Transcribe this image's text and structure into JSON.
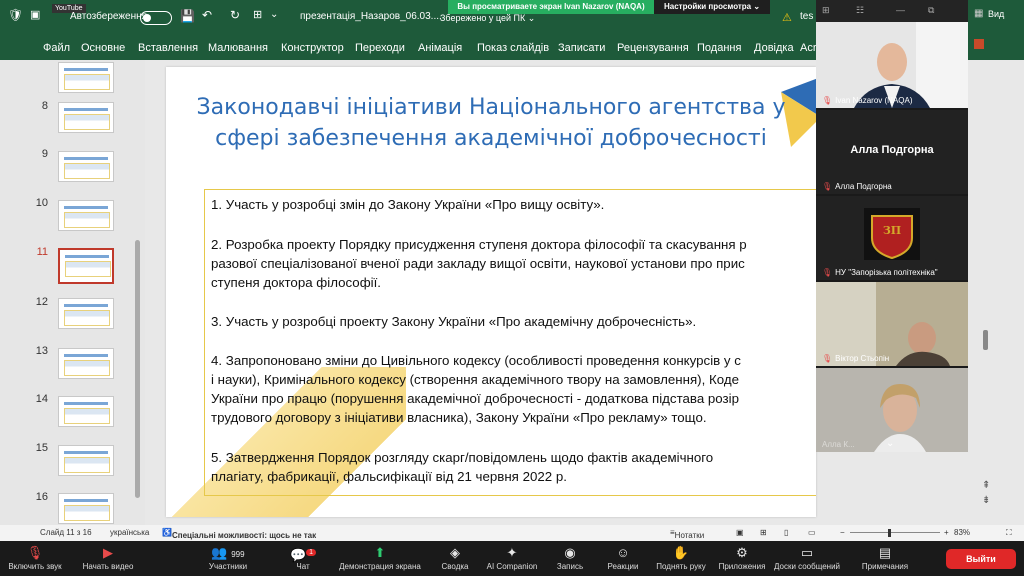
{
  "titlebar": {
    "app_badge": "YouTube",
    "autosave_label": "Автозбереження",
    "filename": "презентація_Назаров_06.03....",
    "saved_status": "Збережено у цей ПК",
    "search_partial": "tes"
  },
  "share_banner": {
    "message": "Вы просматриваете экран Ivan Nazarov (NAQA)",
    "options_label": "Настройки просмотра"
  },
  "ribbon": {
    "tabs": [
      "Файл",
      "Основне",
      "Вставлення",
      "Малювання",
      "Конструктор",
      "Переходи",
      "Анімація",
      "Показ слайдів",
      "Записати",
      "Рецензування",
      "Подання",
      "Довідка",
      "Acr"
    ]
  },
  "thumbnails": [
    {
      "num": ""
    },
    {
      "num": "8"
    },
    {
      "num": "9"
    },
    {
      "num": "10"
    },
    {
      "num": "11"
    },
    {
      "num": "12"
    },
    {
      "num": "13"
    },
    {
      "num": "14"
    },
    {
      "num": "15"
    },
    {
      "num": "16"
    }
  ],
  "slide": {
    "title_line1": "Законодавчі ініціативи Національного агентства у",
    "title_line2": "сфері забезпечення академічної доброчесності",
    "items": [
      "1. Участь у розробці змін до Закону України «Про вищу освіту».",
      "2. Розробка проекту Порядку присудження ступеня доктора філософії та скасування р",
      "разової спеціалізованої вченої ради закладу вищої освіти, наукової установи про прис",
      "ступеня доктора філософії.",
      "3. Участь у розробці проекту Закону України «Про академічну доброчесність».",
      "4. Запропоновано зміни до Цивільного кодексу (особливості проведення конкурсів у с",
      "і науки), Кримінального кодексу (створення академічного твору на замовлення), Коде",
      "України про працю (порушення академічної доброчесності - додаткова підстава розір",
      "трудового договору з ініціативи власника), Закону України «Про рекламу» тощо.",
      "5. Затвердження Порядок розгляду скарг/повідомлень щодо фактів академічного",
      "плагіату, фабрикації, фальсифікації від 21 червня 2022 р."
    ]
  },
  "participants": {
    "view_label": "Вид",
    "list": [
      {
        "name": "Ivan Nazarov (NAQA)"
      },
      {
        "name": "Алла Подгорна",
        "display": "Алла Подгорна"
      },
      {
        "name": "НУ \"Запорізька політехніка\""
      },
      {
        "name": "Віктор Стьопін"
      },
      {
        "name": "Алла К..."
      }
    ]
  },
  "status": {
    "slide": "Слайд 11 з 16",
    "language": "українська",
    "accessibility": "Спеціальні можливості: щось не так",
    "notes": "Нотатки",
    "zoom": "83%"
  },
  "zoombar": {
    "mic": "Включить звук",
    "video": "Начать видео",
    "participants_count": "999",
    "participants": "Участники",
    "chat": "Чат",
    "chat_badge": "1",
    "share": "Демонстрация экрана",
    "summary": "Сводка",
    "companion": "AI Companion",
    "record": "Запись",
    "reactions": "Реакции",
    "raise_hand": "Поднять руку",
    "apps": "Приложения",
    "whiteboards": "Доски сообщений",
    "notes": "Примечания",
    "leave": "Выйти"
  },
  "colors": {
    "ribbon": "#1e5a3a",
    "title_blue": "#2e6cb5",
    "box_border": "#e6c84a",
    "share_green": "#27ae60",
    "leave_red": "#e02828"
  }
}
